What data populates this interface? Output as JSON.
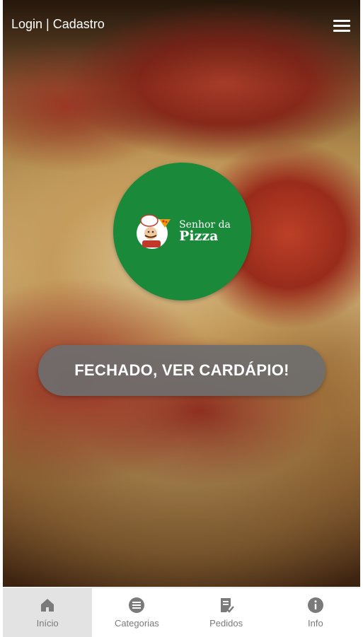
{
  "header": {
    "login_label": "Login | Cadastro",
    "menu_icon": "hamburger-menu-icon"
  },
  "logo": {
    "line1": "Senhor da",
    "line2": "Pizza",
    "background": "#1a8a3a"
  },
  "cta": {
    "label": "FECHADO, VER CARDÁPIO!"
  },
  "tabs": [
    {
      "label": "Início",
      "icon": "home-icon",
      "active": true
    },
    {
      "label": "Categorias",
      "icon": "list-circle-icon",
      "active": false
    },
    {
      "label": "Pedidos",
      "icon": "receipt-check-icon",
      "active": false
    },
    {
      "label": "Info",
      "icon": "info-icon",
      "active": false
    }
  ],
  "colors": {
    "brand_green": "#1a8a3a",
    "cta_gray": "#6e6e6e",
    "tab_icon": "#7a7a7a",
    "tab_active_bg": "#e3e3e3"
  }
}
